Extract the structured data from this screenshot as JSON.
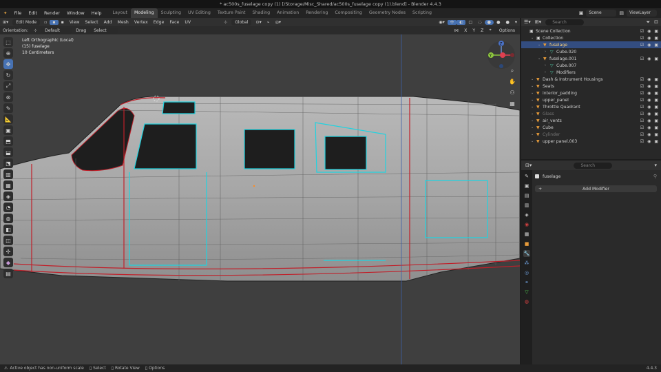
{
  "window_title": "* ac500s_fuselage copy (1) [/Storage/Misc_Shared/ac500s_fuselage copy (1).blend] - Blender 4.4.3",
  "menus": [
    "File",
    "Edit",
    "Render",
    "Window",
    "Help"
  ],
  "workspaces": [
    {
      "label": "Layout",
      "active": false
    },
    {
      "label": "Modeling",
      "active": true
    },
    {
      "label": "Sculpting",
      "active": false
    },
    {
      "label": "UV Editing",
      "active": false
    },
    {
      "label": "Texture Paint",
      "active": false
    },
    {
      "label": "Shading",
      "active": false
    },
    {
      "label": "Animation",
      "active": false
    },
    {
      "label": "Rendering",
      "active": false
    },
    {
      "label": "Compositing",
      "active": false
    },
    {
      "label": "Geometry Nodes",
      "active": false
    },
    {
      "label": "Scripting",
      "active": false
    }
  ],
  "scene": {
    "label": "Scene",
    "view_layer": "ViewLayer"
  },
  "viewport_header": {
    "mode": "Edit Mode",
    "menus": [
      "View",
      "Select",
      "Add",
      "Mesh",
      "Vertex",
      "Edge",
      "Face",
      "UV"
    ],
    "transform_orientation": "Global",
    "axes": [
      "X",
      "Y",
      "Z"
    ],
    "options": "Options"
  },
  "tool_settings": {
    "orientation_label": "Orientation:",
    "orientation_value": "Default",
    "drag_label": "Drag",
    "drag_value": "Select Box"
  },
  "overlay": {
    "view_name": "Left Orthographic (Local)",
    "object_info": "(15) fuselage",
    "scale_info": "10 Centimeters"
  },
  "gizmo": {
    "x": "X",
    "y": "Y",
    "z": "Z"
  },
  "outliner": {
    "search_placeholder": "Search",
    "items": [
      {
        "label": "Scene Collection",
        "indent": 0,
        "selected": false,
        "muted": false
      },
      {
        "label": "Collection",
        "indent": 1,
        "selected": false,
        "muted": false
      },
      {
        "label": "fuselage",
        "indent": 2,
        "selected": true,
        "muted": false
      },
      {
        "label": "Cube.020",
        "indent": 3,
        "selected": false,
        "muted": false
      },
      {
        "label": "fuselage.001",
        "indent": 2,
        "selected": false,
        "muted": false
      },
      {
        "label": "Cube.007",
        "indent": 3,
        "selected": false,
        "muted": false
      },
      {
        "label": "Modifiers",
        "indent": 3,
        "selected": false,
        "muted": false
      },
      {
        "label": "Dash & Instrument Housings",
        "indent": 1,
        "selected": false,
        "muted": false
      },
      {
        "label": "Seats",
        "indent": 1,
        "selected": false,
        "muted": false
      },
      {
        "label": "interior_padding",
        "indent": 1,
        "selected": false,
        "muted": false
      },
      {
        "label": "upper_panel",
        "indent": 1,
        "selected": false,
        "muted": false
      },
      {
        "label": "Throttle Quadrant",
        "indent": 1,
        "selected": false,
        "muted": false
      },
      {
        "label": "Glass",
        "indent": 1,
        "selected": false,
        "muted": true
      },
      {
        "label": "air_vents",
        "indent": 1,
        "selected": false,
        "muted": false
      },
      {
        "label": "Cube",
        "indent": 1,
        "selected": false,
        "muted": false
      },
      {
        "label": "Cylinder",
        "indent": 1,
        "selected": false,
        "muted": true
      },
      {
        "label": "upper panel.003",
        "indent": 1,
        "selected": false,
        "muted": false
      }
    ]
  },
  "properties": {
    "search_placeholder": "Search",
    "object_name": "fuselage",
    "add_modifier": "Add Modifier"
  },
  "statusbar": {
    "message": "Active object has non-uniform scale",
    "select": "Select",
    "rotate": "Rotate View",
    "options": "Options",
    "version": "4.4.3"
  },
  "colors": {
    "selection_blue": "#4772b3",
    "seam_red": "#c0202a",
    "sharp_cyan": "#1fd3e0",
    "outliner_select": "#334d80"
  }
}
